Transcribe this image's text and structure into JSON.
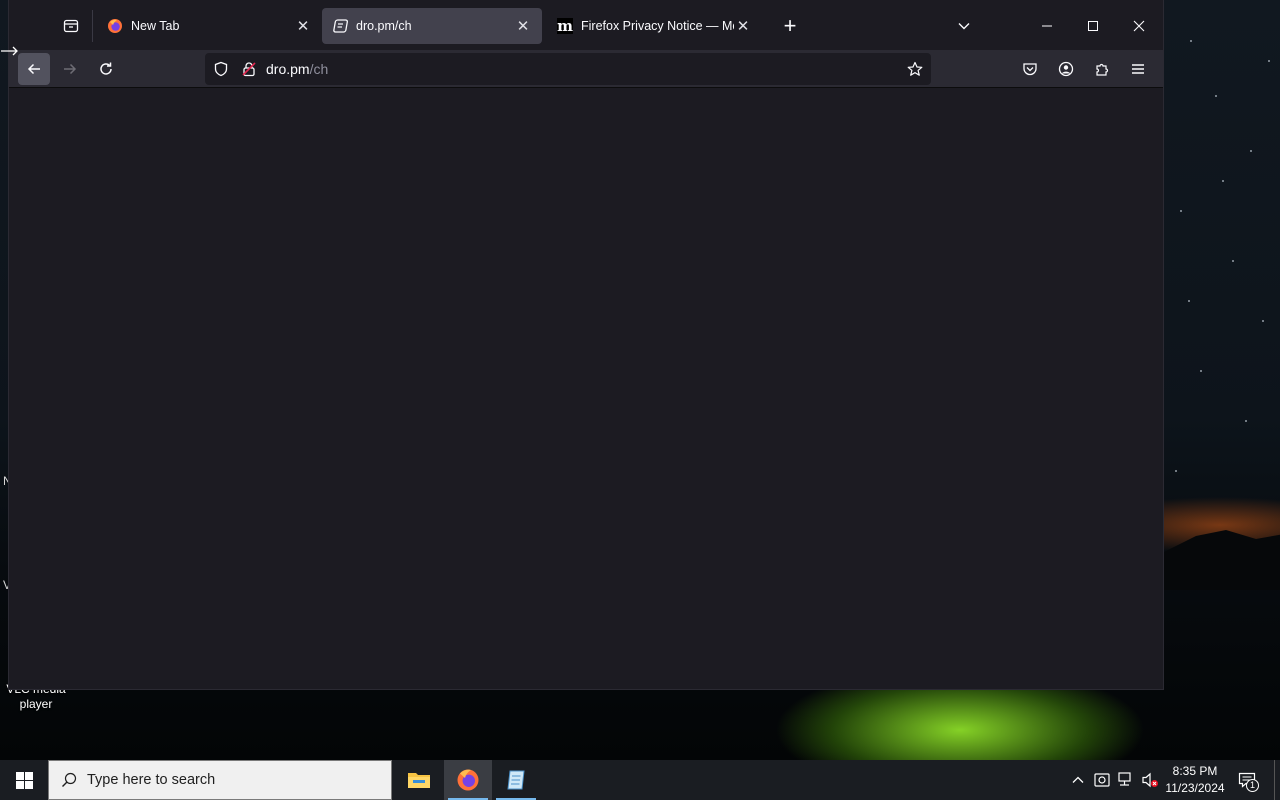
{
  "desktop": {
    "icons": [
      {
        "label": "VLC media player"
      }
    ],
    "edge_letters": [
      "N",
      "V"
    ]
  },
  "browser": {
    "tabs": [
      {
        "title": "New Tab",
        "favicon": "firefox-icon",
        "active": false
      },
      {
        "title": "dro.pm/ch",
        "favicon": "page-icon",
        "active": true
      },
      {
        "title": "Firefox Privacy Notice — Mozilla",
        "favicon": "mozilla-m-icon",
        "active": false
      }
    ],
    "url": {
      "host": "dro.pm",
      "path": "/ch"
    },
    "new_tab_symbol": "+",
    "close_symbol": "✕"
  },
  "taskbar": {
    "search_placeholder": "Type here to search",
    "time": "8:35 PM",
    "date": "11/23/2024",
    "notification_count": "1",
    "accent_color": "#76b9ed"
  }
}
